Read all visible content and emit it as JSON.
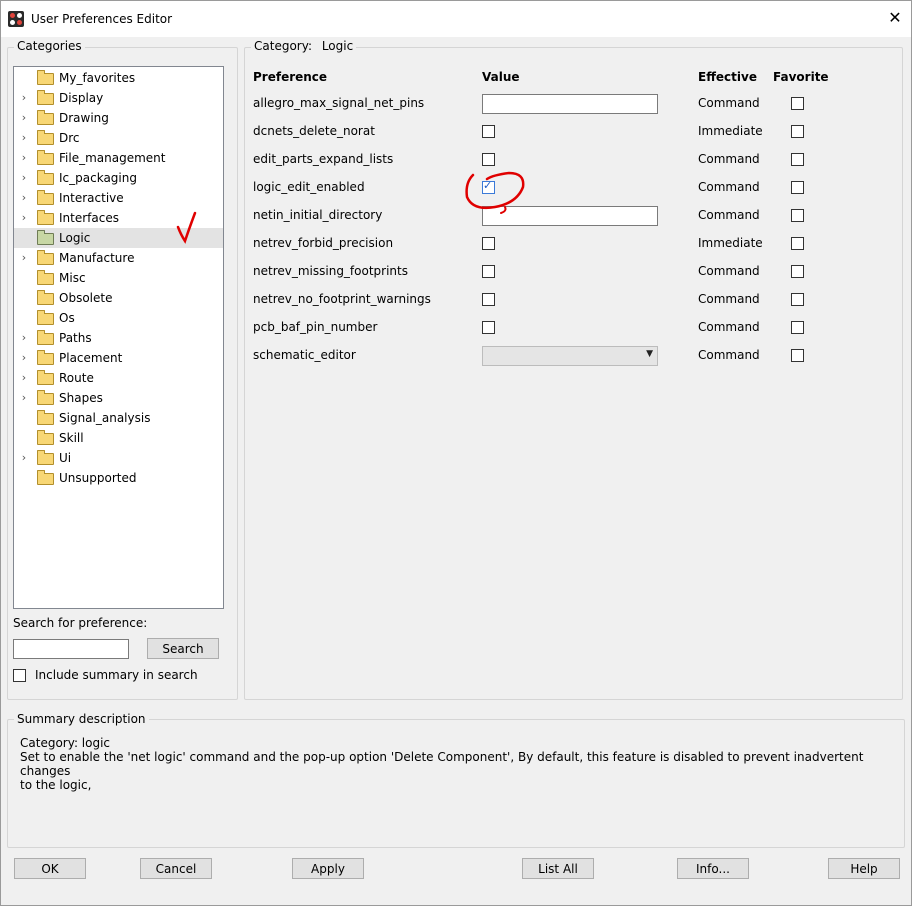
{
  "window": {
    "title": "User Preferences Editor",
    "close_icon": "close-icon"
  },
  "categories": {
    "label": "Categories",
    "items": [
      {
        "label": "My_favorites",
        "expandable": false,
        "selected": false
      },
      {
        "label": "Display",
        "expandable": true,
        "selected": false
      },
      {
        "label": "Drawing",
        "expandable": true,
        "selected": false
      },
      {
        "label": "Drc",
        "expandable": true,
        "selected": false
      },
      {
        "label": "File_management",
        "expandable": true,
        "selected": false
      },
      {
        "label": "Ic_packaging",
        "expandable": true,
        "selected": false
      },
      {
        "label": "Interactive",
        "expandable": true,
        "selected": false
      },
      {
        "label": "Interfaces",
        "expandable": true,
        "selected": false
      },
      {
        "label": "Logic",
        "expandable": false,
        "selected": true
      },
      {
        "label": "Manufacture",
        "expandable": true,
        "selected": false
      },
      {
        "label": "Misc",
        "expandable": false,
        "selected": false
      },
      {
        "label": "Obsolete",
        "expandable": false,
        "selected": false
      },
      {
        "label": "Os",
        "expandable": false,
        "selected": false
      },
      {
        "label": "Paths",
        "expandable": true,
        "selected": false
      },
      {
        "label": "Placement",
        "expandable": true,
        "selected": false
      },
      {
        "label": "Route",
        "expandable": true,
        "selected": false
      },
      {
        "label": "Shapes",
        "expandable": true,
        "selected": false
      },
      {
        "label": "Signal_analysis",
        "expandable": false,
        "selected": false
      },
      {
        "label": "Skill",
        "expandable": false,
        "selected": false
      },
      {
        "label": "Ui",
        "expandable": true,
        "selected": false
      },
      {
        "label": "Unsupported",
        "expandable": false,
        "selected": false
      }
    ],
    "search": {
      "label": "Search for preference:",
      "value": "",
      "button": "Search",
      "include_summary_label": "Include summary in search",
      "include_summary_checked": false
    }
  },
  "category_panel": {
    "label_prefix": "Category:",
    "category": "Logic",
    "headers": {
      "preference": "Preference",
      "value": "Value",
      "effective": "Effective",
      "favorite": "Favorite"
    },
    "rows": [
      {
        "name": "allegro_max_signal_net_pins",
        "value_type": "text",
        "value": "",
        "effective": "Command",
        "favorite": false
      },
      {
        "name": "dcnets_delete_norat",
        "value_type": "checkbox",
        "checked": false,
        "effective": "Immediate",
        "favorite": false
      },
      {
        "name": "edit_parts_expand_lists",
        "value_type": "checkbox",
        "checked": false,
        "effective": "Command",
        "favorite": false
      },
      {
        "name": "logic_edit_enabled",
        "value_type": "checkbox",
        "checked": true,
        "effective": "Command",
        "favorite": false
      },
      {
        "name": "netin_initial_directory",
        "value_type": "text",
        "value": "",
        "effective": "Command",
        "favorite": false
      },
      {
        "name": "netrev_forbid_precision",
        "value_type": "checkbox",
        "checked": false,
        "effective": "Immediate",
        "favorite": false
      },
      {
        "name": "netrev_missing_footprints",
        "value_type": "checkbox",
        "checked": false,
        "effective": "Command",
        "favorite": false
      },
      {
        "name": "netrev_no_footprint_warnings",
        "value_type": "checkbox",
        "checked": false,
        "effective": "Command",
        "favorite": false
      },
      {
        "name": "pcb_baf_pin_number",
        "value_type": "checkbox",
        "checked": false,
        "effective": "Command",
        "favorite": false
      },
      {
        "name": "schematic_editor",
        "value_type": "combo",
        "value": "",
        "effective": "Command",
        "favorite": false
      }
    ]
  },
  "summary": {
    "label": "Summary description",
    "lines": [
      "Category: logic",
      "Set to enable the 'net logic' command and the pop-up option 'Delete Component', By default, this feature is disabled to prevent inadvertent changes",
      "to the logic,"
    ]
  },
  "buttons": {
    "ok": "OK",
    "cancel": "Cancel",
    "apply": "Apply",
    "list_all": "List All",
    "info": "Info...",
    "help": "Help"
  },
  "colors": {
    "window_bg": "#f0f0f0",
    "selected_row": "#e3e3e3",
    "annotation_red": "#e00000",
    "checkbox_accent": "#1e5bc6"
  }
}
